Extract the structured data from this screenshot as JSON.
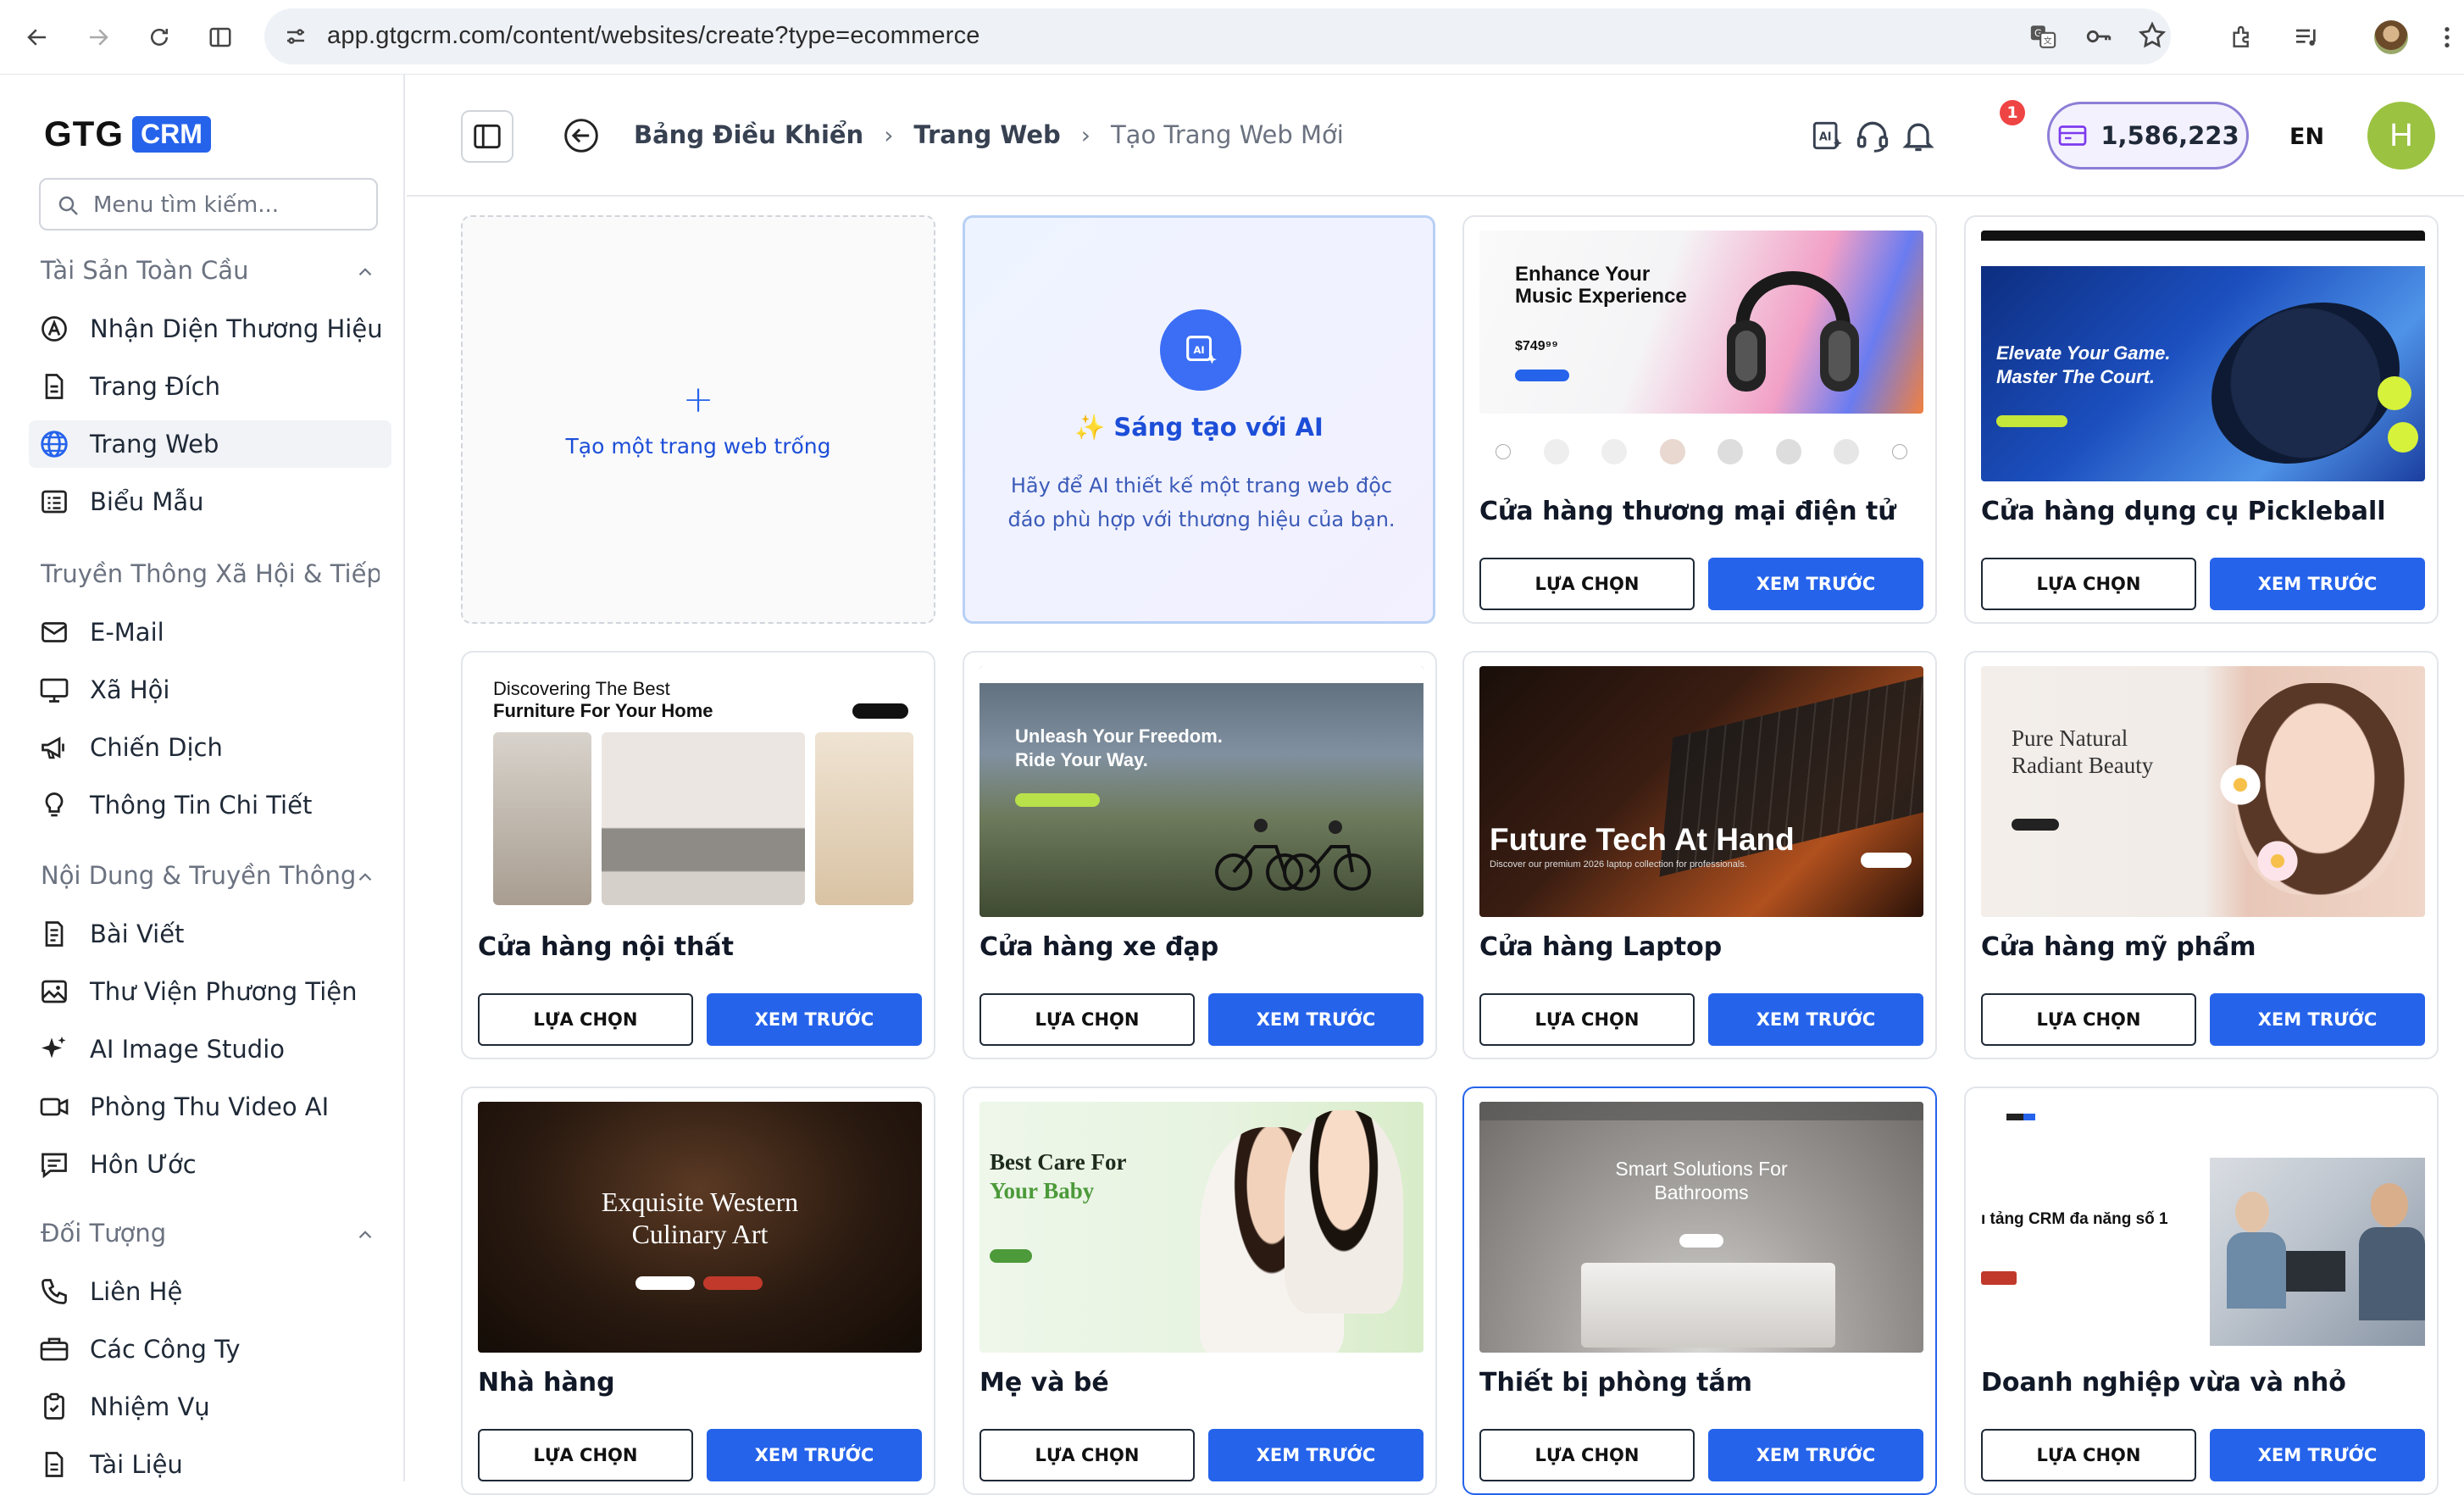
{
  "browser": {
    "url": "app.gtgcrm.com/content/websites/create?type=ecommerce"
  },
  "sidebar": {
    "logo": {
      "left": "GTG",
      "right": "CRM"
    },
    "search_placeholder": "Menu tìm kiếm...",
    "sections": [
      {
        "title": "Tài Sản Toàn Cầu",
        "items": [
          {
            "label": "Nhận Diện Thương Hiệu",
            "icon": "brand-icon"
          },
          {
            "label": "Trang Đích",
            "icon": "page-icon"
          },
          {
            "label": "Trang Web",
            "icon": "globe-icon",
            "active": true
          },
          {
            "label": "Biểu Mẫu",
            "icon": "form-icon"
          }
        ]
      },
      {
        "title": "Truyền Thông Xã Hội & Tiếp Th",
        "items": [
          {
            "label": "E-Mail",
            "icon": "mail-icon"
          },
          {
            "label": "Xã Hội",
            "icon": "monitor-icon"
          },
          {
            "label": "Chiến Dịch",
            "icon": "megaphone-icon"
          },
          {
            "label": "Thông Tin Chi Tiết",
            "icon": "bulb-icon"
          }
        ]
      },
      {
        "title": "Nội Dung & Truyền Thông",
        "items": [
          {
            "label": "Bài Viết",
            "icon": "article-icon"
          },
          {
            "label": "Thư Viện Phương Tiện",
            "icon": "image-icon"
          },
          {
            "label": "AI Image Studio",
            "icon": "sparkle-icon"
          },
          {
            "label": "Phòng Thu Video AI",
            "icon": "video-icon"
          },
          {
            "label": "Hôn Ước",
            "icon": "chat-icon"
          }
        ]
      },
      {
        "title": "Đối Tượng",
        "items": [
          {
            "label": "Liên Hệ",
            "icon": "phone-icon"
          },
          {
            "label": "Các Công Ty",
            "icon": "briefcase-icon"
          },
          {
            "label": "Nhiệm Vụ",
            "icon": "clipboard-icon"
          },
          {
            "label": "Tài Liệu",
            "icon": "document-icon"
          }
        ]
      }
    ]
  },
  "header": {
    "breadcrumb": [
      "Bảng Điều Khiển",
      "Trang Web",
      "Tạo Trang Web Mới"
    ],
    "notification_count": "1",
    "credits": "1,586,223",
    "language": "EN",
    "avatar_initial": "H"
  },
  "blank_card": {
    "label": "Tạo một trang web trống"
  },
  "ai_card": {
    "title": "✨ Sáng tạo với AI",
    "description": "Hãy để AI thiết kế một trang web độc đáo phù hợp với thương hiệu của bạn.",
    "badge": "AI"
  },
  "buttons": {
    "select": "LỰA CHỌN",
    "preview": "XEM TRƯỚC"
  },
  "templates": [
    {
      "title": "Cửa hàng thương mại điện tử",
      "thumb": {
        "h1": "Enhance Your",
        "h2": "Music Experience",
        "price": "$749⁹⁹"
      }
    },
    {
      "title": "Cửa hàng dụng cụ Pickleball",
      "thumb": {
        "h1": "Elevate Your Game.",
        "h2": "Master The Court."
      }
    },
    {
      "title": "Cửa hàng nội thất",
      "thumb": {
        "h1": "Discovering The Best",
        "h2": "Furniture For Your Home"
      }
    },
    {
      "title": "Cửa hàng xe đạp",
      "thumb": {
        "h1": "Unleash Your Freedom.",
        "h2": "Ride Your Way."
      }
    },
    {
      "title": "Cửa hàng Laptop",
      "thumb": {
        "h1": "Future Tech At Hand",
        "h2": "Discover our premium 2026 laptop collection for professionals."
      }
    },
    {
      "title": "Cửa hàng mỹ phẩm",
      "thumb": {
        "h1": "Pure Natural",
        "h2": "Radiant Beauty"
      }
    },
    {
      "title": "Nhà hàng",
      "thumb": {
        "h1": "Exquisite Western",
        "h2": "Culinary Art"
      }
    },
    {
      "title": "Mẹ và bé",
      "thumb": {
        "h1": "Best Care For",
        "h2": "Your Baby"
      }
    },
    {
      "title": "Thiết bị phòng tắm",
      "thumb": {
        "h1": "Smart Solutions For",
        "h2": "Bathrooms"
      }
    },
    {
      "title": "Doanh nghiệp vừa và nhỏ",
      "thumb": {
        "h1": "ı tảng CRM đa năng số 1",
        "h2": ""
      }
    }
  ]
}
